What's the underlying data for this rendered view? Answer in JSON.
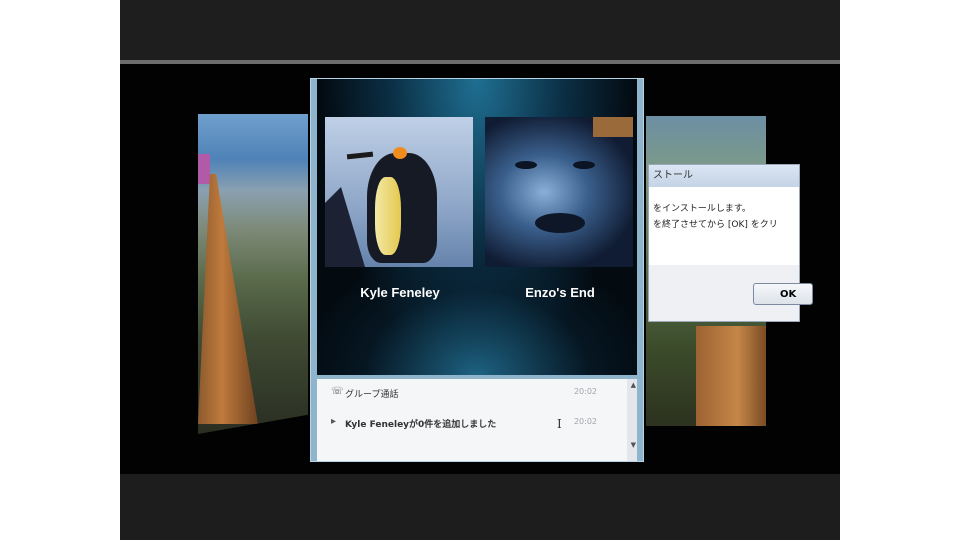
{
  "call_window": {
    "participants": [
      {
        "name": "Kyle Feneley",
        "avatar": "penguin"
      },
      {
        "name": "Enzo's End",
        "avatar": "face"
      }
    ],
    "chat": [
      {
        "icon": "phone-icon",
        "text": "グループ通話",
        "time": "20:02"
      },
      {
        "icon": "chevron-right-icon",
        "text": "Kyle Feneleyが0件を追加しました",
        "time": "20:02"
      }
    ]
  },
  "installer_dialog": {
    "title": "ストール",
    "message_line1": "をインストールします。",
    "message_line2": "を終了させてから [OK] をクリ",
    "ok_label": "OK"
  }
}
